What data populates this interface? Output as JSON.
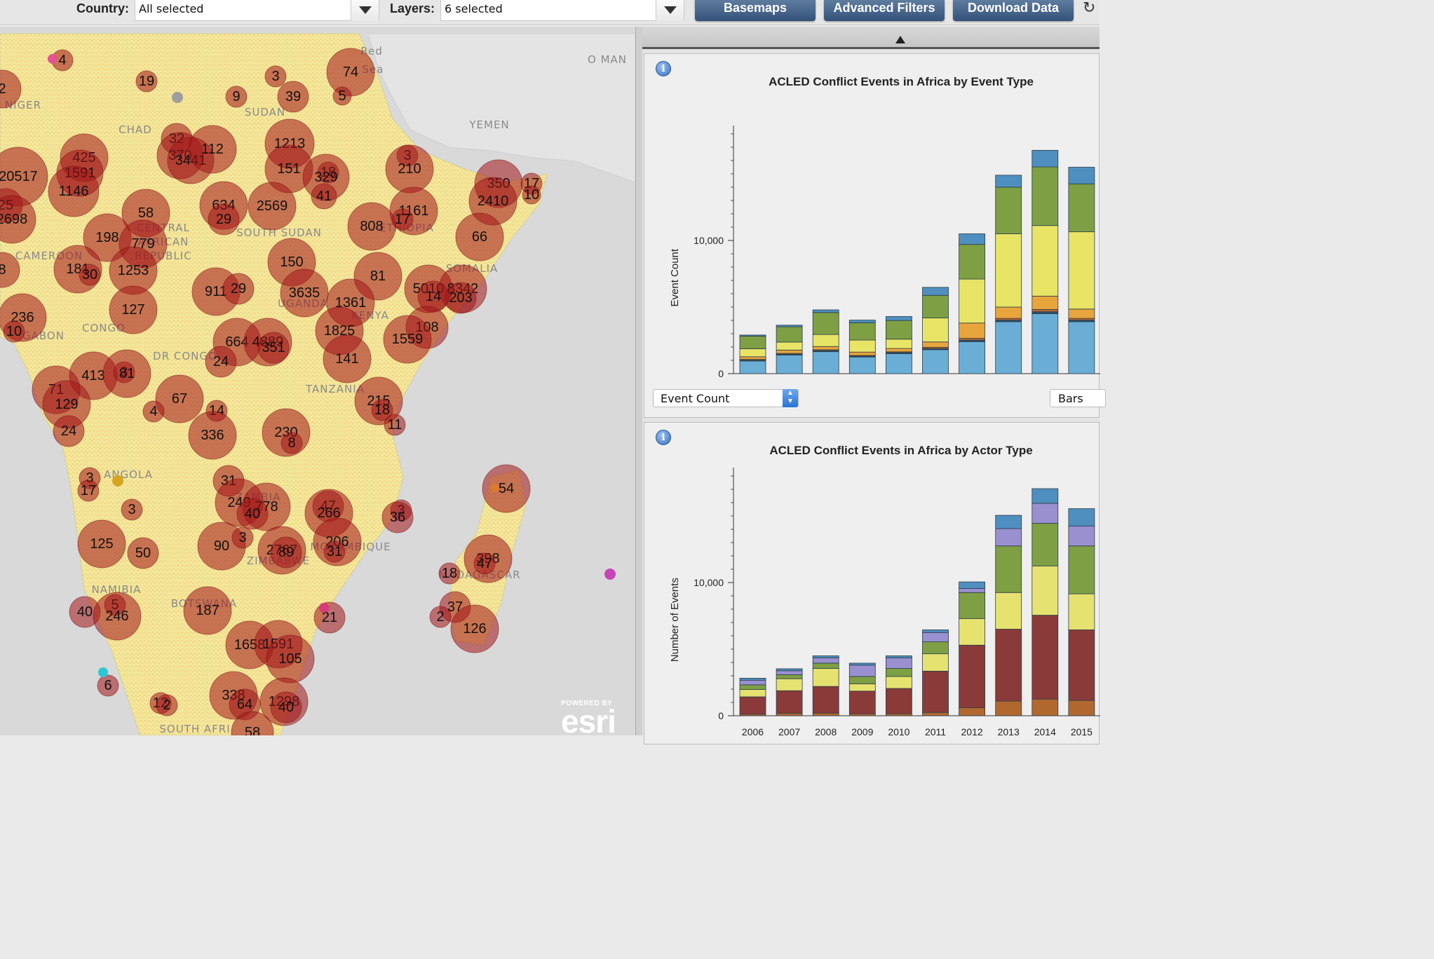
{
  "filters": {
    "country_label": "Country:",
    "country_value": "All selected",
    "layers_label": "Layers:",
    "layers_value": "6 selected"
  },
  "toolbar": {
    "basemaps": "Basemaps",
    "advanced_filters": "Advanced Filters",
    "download_data": "Download Data",
    "refresh_icon": "refresh-icon"
  },
  "map": {
    "regions": [
      {
        "name": "NIGER",
        "x": 33,
        "y": 155
      },
      {
        "name": "CHAD",
        "x": 193,
        "y": 190
      },
      {
        "name": "SUDAN",
        "x": 378,
        "y": 165
      },
      {
        "name": "YEMEN",
        "x": 698,
        "y": 183
      },
      {
        "name": "O MAN",
        "x": 866,
        "y": 90
      },
      {
        "name": "SOUTH SUDAN",
        "x": 398,
        "y": 337
      },
      {
        "name": "CENTRAL",
        "x": 233,
        "y": 330
      },
      {
        "name": "AFRICAN",
        "x": 233,
        "y": 350
      },
      {
        "name": "REPUBLIC",
        "x": 233,
        "y": 370
      },
      {
        "name": "CAMEROON",
        "x": 70,
        "y": 370
      },
      {
        "name": "GABON",
        "x": 62,
        "y": 484
      },
      {
        "name": "CONGO",
        "x": 148,
        "y": 473
      },
      {
        "name": "DR CONGO",
        "x": 264,
        "y": 513
      },
      {
        "name": "ETHIOPIA",
        "x": 580,
        "y": 330
      },
      {
        "name": "SOMALIA",
        "x": 673,
        "y": 388
      },
      {
        "name": "UGANDA",
        "x": 432,
        "y": 438
      },
      {
        "name": "KENYA",
        "x": 528,
        "y": 455
      },
      {
        "name": "TANZANIA",
        "x": 478,
        "y": 560
      },
      {
        "name": "ANGOLA",
        "x": 183,
        "y": 682
      },
      {
        "name": "ZAMBIA",
        "x": 368,
        "y": 714
      },
      {
        "name": "MOZAMBIQUE",
        "x": 500,
        "y": 785
      },
      {
        "name": "ZIMBABWE",
        "x": 397,
        "y": 805
      },
      {
        "name": "NAMIBIA",
        "x": 166,
        "y": 846
      },
      {
        "name": "BOTSWANA",
        "x": 291,
        "y": 866
      },
      {
        "name": "MADAGASCAR",
        "x": 684,
        "y": 825
      },
      {
        "name": "SOUTH AFRI",
        "x": 278,
        "y": 1045
      },
      {
        "name": "Red",
        "x": 530,
        "y": 78
      },
      {
        "name": "Sea",
        "x": 532,
        "y": 104
      }
    ],
    "bubbles": [
      {
        "label": "4",
        "x": 89,
        "y": 86,
        "r": 15
      },
      {
        "label": "19",
        "x": 209,
        "y": 116,
        "r": 15
      },
      {
        "label": "9",
        "x": 337,
        "y": 138,
        "r": 15
      },
      {
        "label": "3",
        "x": 393,
        "y": 109,
        "r": 15
      },
      {
        "label": "39",
        "x": 418,
        "y": 138,
        "r": 22
      },
      {
        "label": "74",
        "x": 500,
        "y": 103,
        "r": 34
      },
      {
        "label": "5",
        "x": 488,
        "y": 137,
        "r": 13
      },
      {
        "label": "2",
        "x": 3,
        "y": 127,
        "r": 27
      },
      {
        "label": "425",
        "x": 120,
        "y": 225,
        "r": 34
      },
      {
        "label": "1591",
        "x": 114,
        "y": 247,
        "r": 33
      },
      {
        "label": "20517",
        "x": 26,
        "y": 252,
        "r": 42
      },
      {
        "label": "1146",
        "x": 105,
        "y": 273,
        "r": 36
      },
      {
        "label": "25",
        "x": 8,
        "y": 293,
        "r": 24
      },
      {
        "label": "2698",
        "x": 17,
        "y": 313,
        "r": 34
      },
      {
        "label": "32",
        "x": 252,
        "y": 198,
        "r": 22
      },
      {
        "label": "370",
        "x": 257,
        "y": 222,
        "r": 33
      },
      {
        "label": "3441",
        "x": 272,
        "y": 229,
        "r": 33
      },
      {
        "label": "112",
        "x": 303,
        "y": 213,
        "r": 34
      },
      {
        "label": "1213",
        "x": 413,
        "y": 205,
        "r": 35
      },
      {
        "label": "151",
        "x": 412,
        "y": 241,
        "r": 34
      },
      {
        "label": "18",
        "x": 468,
        "y": 246,
        "r": 15
      },
      {
        "label": "329",
        "x": 465,
        "y": 253,
        "r": 33
      },
      {
        "label": "41",
        "x": 462,
        "y": 280,
        "r": 18
      },
      {
        "label": "3",
        "x": 581,
        "y": 222,
        "r": 15
      },
      {
        "label": "210",
        "x": 584,
        "y": 241,
        "r": 34
      },
      {
        "label": "58",
        "x": 208,
        "y": 304,
        "r": 34
      },
      {
        "label": "634",
        "x": 319,
        "y": 293,
        "r": 34
      },
      {
        "label": "29",
        "x": 319,
        "y": 313,
        "r": 22
      },
      {
        "label": "2569",
        "x": 388,
        "y": 294,
        "r": 34
      },
      {
        "label": "1161",
        "x": 590,
        "y": 301,
        "r": 34
      },
      {
        "label": "17",
        "x": 574,
        "y": 313,
        "r": 15
      },
      {
        "label": "808",
        "x": 530,
        "y": 323,
        "r": 34
      },
      {
        "label": "350",
        "x": 711,
        "y": 262,
        "r": 34
      },
      {
        "label": "17",
        "x": 758,
        "y": 262,
        "r": 15
      },
      {
        "label": "10",
        "x": 758,
        "y": 278,
        "r": 13
      },
      {
        "label": "2410",
        "x": 703,
        "y": 287,
        "r": 34
      },
      {
        "label": "66",
        "x": 684,
        "y": 338,
        "r": 34
      },
      {
        "label": "198",
        "x": 153,
        "y": 339,
        "r": 34
      },
      {
        "label": "779",
        "x": 204,
        "y": 348,
        "r": 34
      },
      {
        "label": "181",
        "x": 111,
        "y": 384,
        "r": 34
      },
      {
        "label": "30",
        "x": 128,
        "y": 392,
        "r": 15
      },
      {
        "label": "1253",
        "x": 190,
        "y": 386,
        "r": 34
      },
      {
        "label": "8",
        "x": 3,
        "y": 385,
        "r": 25
      },
      {
        "label": "150",
        "x": 416,
        "y": 374,
        "r": 34
      },
      {
        "label": "81",
        "x": 539,
        "y": 394,
        "r": 34
      },
      {
        "label": "911",
        "x": 308,
        "y": 416,
        "r": 34
      },
      {
        "label": "29",
        "x": 340,
        "y": 412,
        "r": 22
      },
      {
        "label": "3635",
        "x": 434,
        "y": 418,
        "r": 34
      },
      {
        "label": "5010",
        "x": 611,
        "y": 412,
        "r": 34
      },
      {
        "label": "8342",
        "x": 660,
        "y": 412,
        "r": 34
      },
      {
        "label": "14",
        "x": 618,
        "y": 423,
        "r": 22
      },
      {
        "label": "203",
        "x": 657,
        "y": 425,
        "r": 22
      },
      {
        "label": "1361",
        "x": 500,
        "y": 432,
        "r": 34
      },
      {
        "label": "127",
        "x": 190,
        "y": 442,
        "r": 34
      },
      {
        "label": "236",
        "x": 32,
        "y": 453,
        "r": 34
      },
      {
        "label": "10",
        "x": 20,
        "y": 473,
        "r": 15
      },
      {
        "label": "1825",
        "x": 484,
        "y": 472,
        "r": 34
      },
      {
        "label": "108",
        "x": 609,
        "y": 467,
        "r": 30
      },
      {
        "label": "1559",
        "x": 581,
        "y": 484,
        "r": 34
      },
      {
        "label": "664",
        "x": 338,
        "y": 488,
        "r": 34
      },
      {
        "label": "4889",
        "x": 382,
        "y": 488,
        "r": 34
      },
      {
        "label": "351",
        "x": 390,
        "y": 496,
        "r": 22
      },
      {
        "label": "141",
        "x": 495,
        "y": 512,
        "r": 34
      },
      {
        "label": "24",
        "x": 315,
        "y": 516,
        "r": 22
      },
      {
        "label": "413",
        "x": 133,
        "y": 536,
        "r": 34
      },
      {
        "label": "3",
        "x": 177,
        "y": 531,
        "r": 15
      },
      {
        "label": "81",
        "x": 181,
        "y": 533,
        "r": 34
      },
      {
        "label": "71",
        "x": 80,
        "y": 556,
        "r": 34
      },
      {
        "label": "129",
        "x": 95,
        "y": 577,
        "r": 34
      },
      {
        "label": "67",
        "x": 256,
        "y": 569,
        "r": 34
      },
      {
        "label": "4",
        "x": 219,
        "y": 587,
        "r": 15
      },
      {
        "label": "14",
        "x": 309,
        "y": 586,
        "r": 15
      },
      {
        "label": "215",
        "x": 540,
        "y": 572,
        "r": 34
      },
      {
        "label": "18",
        "x": 545,
        "y": 585,
        "r": 15
      },
      {
        "label": "11",
        "x": 563,
        "y": 606,
        "r": 15
      },
      {
        "label": "24",
        "x": 98,
        "y": 615,
        "r": 22
      },
      {
        "label": "336",
        "x": 303,
        "y": 621,
        "r": 34
      },
      {
        "label": "230",
        "x": 408,
        "y": 617,
        "r": 34
      },
      {
        "label": "8",
        "x": 416,
        "y": 632,
        "r": 15
      },
      {
        "label": "3",
        "x": 128,
        "y": 682,
        "r": 15
      },
      {
        "label": "17",
        "x": 126,
        "y": 700,
        "r": 15
      },
      {
        "label": "31",
        "x": 326,
        "y": 686,
        "r": 22
      },
      {
        "label": "249",
        "x": 341,
        "y": 717,
        "r": 34
      },
      {
        "label": "778",
        "x": 380,
        "y": 723,
        "r": 34
      },
      {
        "label": "40",
        "x": 360,
        "y": 733,
        "r": 22
      },
      {
        "label": "47",
        "x": 468,
        "y": 722,
        "r": 22
      },
      {
        "label": "266",
        "x": 469,
        "y": 732,
        "r": 34
      },
      {
        "label": "3",
        "x": 572,
        "y": 728,
        "r": 15
      },
      {
        "label": "36",
        "x": 567,
        "y": 738,
        "r": 22
      },
      {
        "label": "54",
        "x": 722,
        "y": 697,
        "r": 34
      },
      {
        "label": "3",
        "x": 188,
        "y": 727,
        "r": 15
      },
      {
        "label": "125",
        "x": 145,
        "y": 776,
        "r": 34
      },
      {
        "label": "50",
        "x": 204,
        "y": 789,
        "r": 22
      },
      {
        "label": "90",
        "x": 316,
        "y": 779,
        "r": 34
      },
      {
        "label": "3",
        "x": 346,
        "y": 767,
        "r": 15
      },
      {
        "label": "2767",
        "x": 402,
        "y": 785,
        "r": 34
      },
      {
        "label": "89",
        "x": 408,
        "y": 788,
        "r": 22
      },
      {
        "label": "206",
        "x": 481,
        "y": 773,
        "r": 34
      },
      {
        "label": "31",
        "x": 477,
        "y": 787,
        "r": 15
      },
      {
        "label": "398",
        "x": 696,
        "y": 797,
        "r": 34
      },
      {
        "label": "47",
        "x": 691,
        "y": 804,
        "r": 15
      },
      {
        "label": "18",
        "x": 641,
        "y": 818,
        "r": 15
      },
      {
        "label": "37",
        "x": 649,
        "y": 866,
        "r": 22
      },
      {
        "label": "2",
        "x": 628,
        "y": 880,
        "r": 15
      },
      {
        "label": "126",
        "x": 677,
        "y": 897,
        "r": 34
      },
      {
        "label": "5",
        "x": 164,
        "y": 863,
        "r": 15
      },
      {
        "label": "40",
        "x": 121,
        "y": 873,
        "r": 22
      },
      {
        "label": "246",
        "x": 167,
        "y": 879,
        "r": 34
      },
      {
        "label": "187",
        "x": 296,
        "y": 871,
        "r": 34
      },
      {
        "label": "21",
        "x": 470,
        "y": 881,
        "r": 22
      },
      {
        "label": "1658",
        "x": 356,
        "y": 920,
        "r": 34
      },
      {
        "label": "1591",
        "x": 397,
        "y": 919,
        "r": 34
      },
      {
        "label": "105",
        "x": 414,
        "y": 940,
        "r": 34
      },
      {
        "label": "6",
        "x": 154,
        "y": 978,
        "r": 15
      },
      {
        "label": "12",
        "x": 229,
        "y": 1003,
        "r": 15
      },
      {
        "label": "2",
        "x": 238,
        "y": 1006,
        "r": 15
      },
      {
        "label": "338",
        "x": 333,
        "y": 992,
        "r": 34
      },
      {
        "label": "64",
        "x": 349,
        "y": 1005,
        "r": 22
      },
      {
        "label": "1298",
        "x": 405,
        "y": 1001,
        "r": 34
      },
      {
        "label": "40",
        "x": 408,
        "y": 1009,
        "r": 22
      },
      {
        "label": "58",
        "x": 360,
        "y": 1045,
        "r": 30
      }
    ],
    "markers": [
      {
        "x": 75,
        "y": 84,
        "r": 7,
        "color": "#e3548f"
      },
      {
        "x": 253,
        "y": 139,
        "r": 8,
        "color": "#9e9e9e"
      },
      {
        "x": 168,
        "y": 686,
        "r": 8,
        "color": "#d6a522"
      },
      {
        "x": 870,
        "y": 819,
        "r": 8,
        "color": "#c643b8"
      },
      {
        "x": 147,
        "y": 959,
        "r": 7,
        "color": "#2ec7d6"
      },
      {
        "x": 462,
        "y": 867,
        "r": 7,
        "color": "#d83a7a"
      },
      {
        "x": 706,
        "y": 696,
        "r": 6,
        "color": "#e07a2a"
      }
    ],
    "esri_powered": "POWERED BY",
    "esri_logo": "esri"
  },
  "charts": {
    "collapse_icon": "collapse-arrow-icon",
    "event_type": {
      "title": "ACLED Conflict Events in Africa by Event Type",
      "info_icon": "info-icon",
      "dropdown_value": "Event Count",
      "view_value": "Bars"
    },
    "actor_type": {
      "title": "ACLED Conflict Events in Africa by Actor Type",
      "info_icon": "info-icon"
    }
  },
  "chart_data": [
    {
      "type": "bar",
      "title": "ACLED Conflict Events in Africa by Event Type",
      "ylabel": "Event Count",
      "xlabel": "",
      "categories": [
        "2006",
        "2007",
        "2008",
        "2009",
        "2010",
        "2011",
        "2012",
        "2013",
        "2014",
        "2015"
      ],
      "ylim": [
        0,
        18000
      ],
      "yticks": [
        0,
        10000
      ],
      "ytick_labels": [
        "0",
        "10,000"
      ],
      "stacked": true,
      "series": [
        {
          "color": "#6aaed6",
          "values": [
            950,
            1400,
            1650,
            1250,
            1500,
            1800,
            2400,
            3900,
            4500,
            3900
          ]
        },
        {
          "color": "#2f4f63",
          "values": [
            60,
            60,
            80,
            60,
            80,
            80,
            120,
            120,
            150,
            120
          ]
        },
        {
          "color": "#c16a33",
          "values": [
            60,
            60,
            60,
            60,
            60,
            100,
            130,
            130,
            170,
            130
          ]
        },
        {
          "color": "#e8a53c",
          "values": [
            200,
            250,
            250,
            250,
            250,
            400,
            1150,
            850,
            1000,
            700
          ]
        },
        {
          "color": "#e8e466",
          "values": [
            600,
            600,
            900,
            900,
            700,
            1800,
            3300,
            5500,
            5300,
            5800
          ]
        },
        {
          "color": "#7e9f44",
          "values": [
            950,
            1150,
            1650,
            1300,
            1400,
            1700,
            2600,
            3500,
            4400,
            3600
          ]
        },
        {
          "color": "#4f8fbf",
          "values": [
            80,
            120,
            200,
            200,
            300,
            600,
            800,
            900,
            1250,
            1250
          ]
        }
      ]
    },
    {
      "type": "bar",
      "title": "ACLED Conflict Events in Africa by Actor Type",
      "ylabel": "Number of Events",
      "xlabel": "",
      "categories": [
        "2006",
        "2007",
        "2008",
        "2009",
        "2010",
        "2011",
        "2012",
        "2013",
        "2014",
        "2015"
      ],
      "ylim": [
        0,
        18000
      ],
      "yticks": [
        0,
        10000
      ],
      "ytick_labels": [
        "0",
        "10,000"
      ],
      "stacked": true,
      "series": [
        {
          "color": "#b1682f",
          "values": [
            120,
            180,
            200,
            150,
            150,
            250,
            600,
            1100,
            1250,
            1150
          ]
        },
        {
          "color": "#8b3a3a",
          "values": [
            1300,
            1700,
            2000,
            1700,
            1900,
            3100,
            4700,
            5400,
            6300,
            5300
          ]
        },
        {
          "color": "#e6e270",
          "values": [
            550,
            900,
            1350,
            550,
            900,
            1300,
            2000,
            2750,
            3700,
            2700
          ]
        },
        {
          "color": "#7e9f44",
          "values": [
            350,
            300,
            400,
            550,
            600,
            900,
            1950,
            3500,
            3200,
            3600
          ]
        },
        {
          "color": "#9a90d0",
          "values": [
            350,
            300,
            400,
            850,
            800,
            700,
            300,
            1300,
            1500,
            1500
          ]
        },
        {
          "color": "#4f8fbf",
          "values": [
            150,
            150,
            150,
            150,
            150,
            200,
            500,
            1000,
            1100,
            1300
          ]
        }
      ]
    }
  ]
}
